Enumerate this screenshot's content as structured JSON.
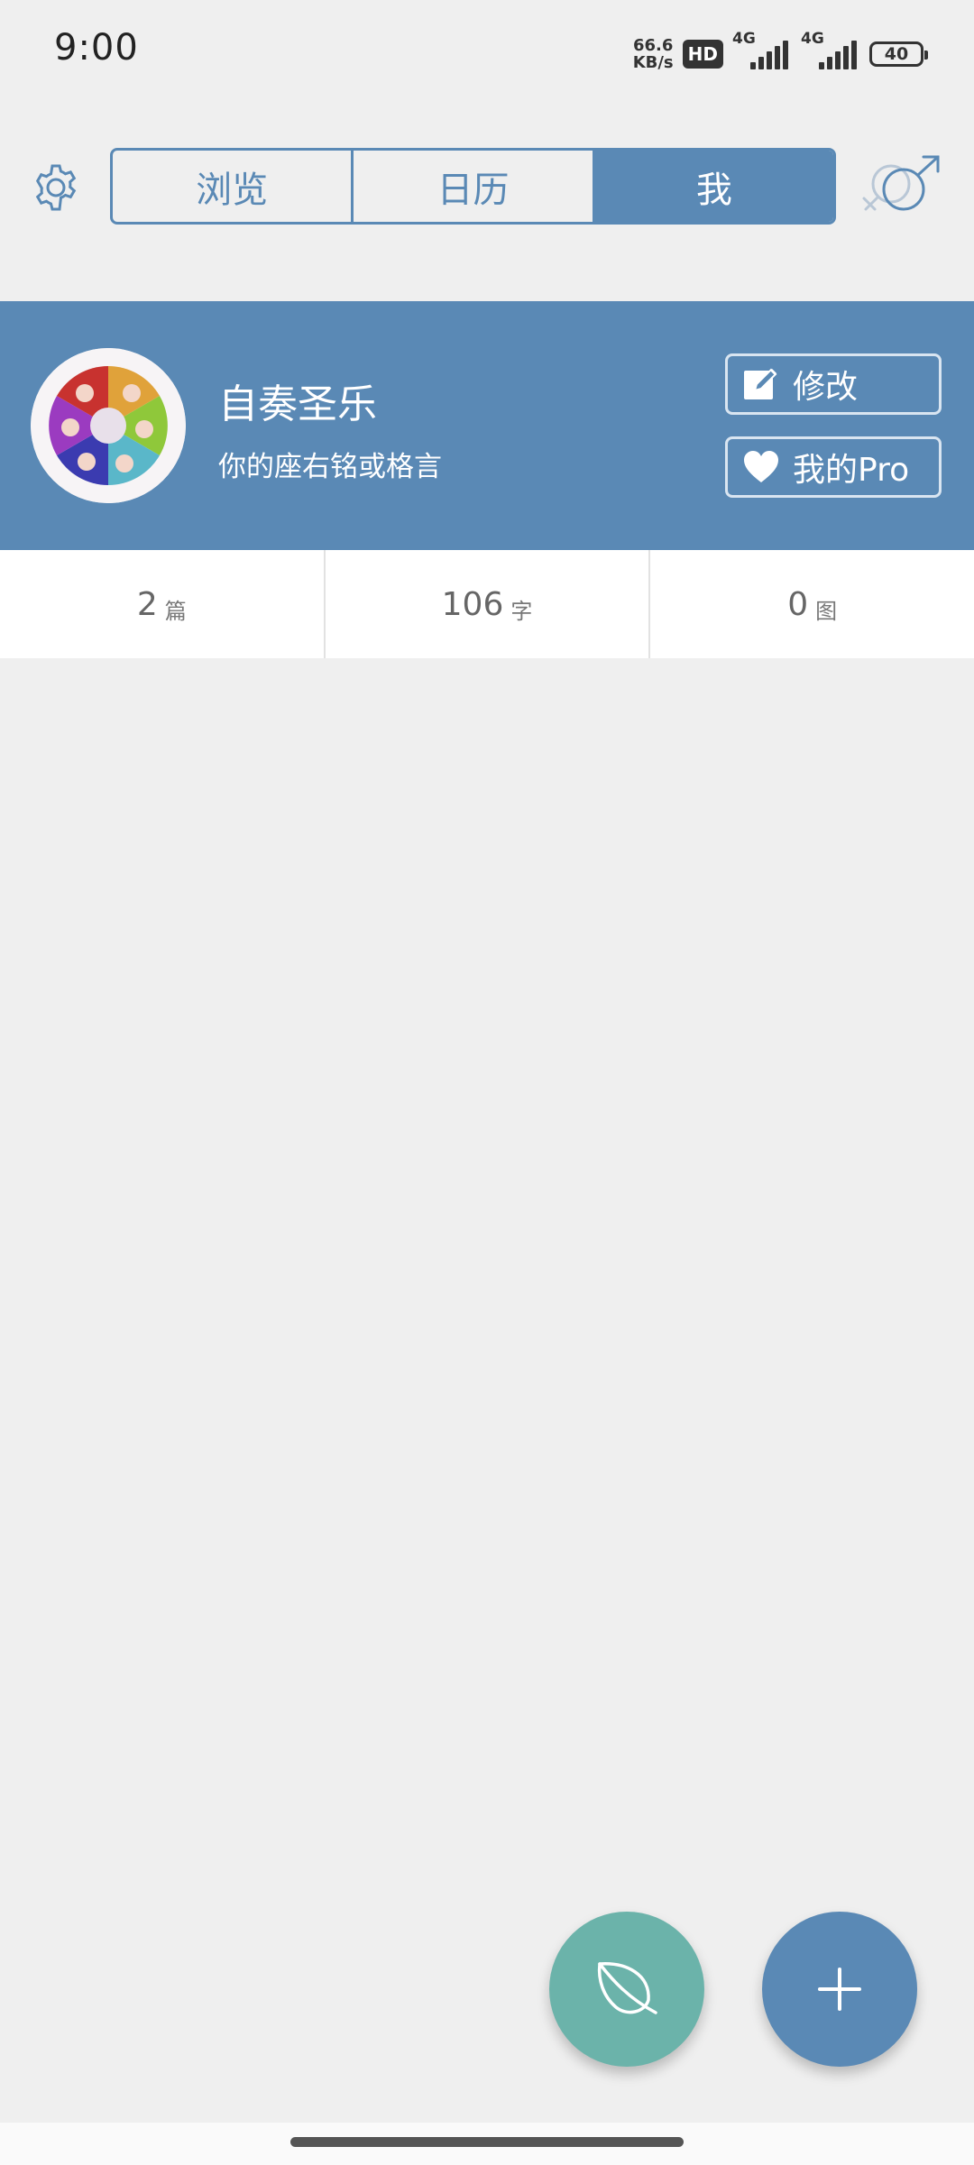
{
  "status_bar": {
    "time": "9:00",
    "net_speed_value": "66.6",
    "net_speed_unit": "KB/s",
    "hd_badge": "HD",
    "sim1_type": "4G",
    "sim2_type": "4G",
    "battery": "40"
  },
  "nav": {
    "tabs": [
      {
        "label": "浏览",
        "active": false
      },
      {
        "label": "日历",
        "active": false
      },
      {
        "label": "我",
        "active": true
      }
    ]
  },
  "profile": {
    "name": "自奏圣乐",
    "motto": "你的座右铭或格言",
    "edit_label": "修改",
    "pro_label": "我的Pro"
  },
  "stats": [
    {
      "value": "2",
      "unit": "篇"
    },
    {
      "value": "106",
      "unit": "字"
    },
    {
      "value": "0",
      "unit": "图"
    }
  ],
  "colors": {
    "accent": "#5a89b5",
    "leaf_fab": "#6bb3aa",
    "background": "#efefef"
  },
  "icons": {
    "settings": "gear-icon",
    "gender": "gender-icon",
    "edit": "edit-icon",
    "pro": "heart-icon",
    "leaf": "leaf-icon",
    "add": "plus-icon"
  }
}
